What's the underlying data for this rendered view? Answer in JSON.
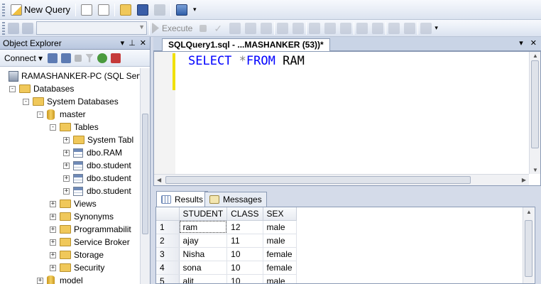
{
  "toolbar": {
    "new_query_label": "New Query",
    "execute_label": "Execute"
  },
  "object_explorer": {
    "title": "Object Explorer",
    "connect_label": "Connect",
    "tree": [
      {
        "label": "RAMASHANKER-PC (SQL Serv",
        "icon": "server-icon",
        "expander": "-"
      },
      {
        "label": "Databases",
        "icon": "folder-icon",
        "expander": "-"
      },
      {
        "label": "System Databases",
        "icon": "folder-icon",
        "expander": "-"
      },
      {
        "label": "master",
        "icon": "database-icon",
        "expander": "-"
      },
      {
        "label": "Tables",
        "icon": "folder-icon",
        "expander": "-"
      },
      {
        "label": "System Tabl",
        "icon": "folder-icon",
        "expander": "+"
      },
      {
        "label": "dbo.RAM",
        "icon": "table-icon",
        "expander": "+"
      },
      {
        "label": "dbo.student",
        "icon": "table-icon",
        "expander": "+"
      },
      {
        "label": "dbo.student",
        "icon": "table-icon",
        "expander": "+"
      },
      {
        "label": "dbo.student",
        "icon": "table-icon",
        "expander": "+"
      },
      {
        "label": "Views",
        "icon": "folder-icon",
        "expander": "+"
      },
      {
        "label": "Synonyms",
        "icon": "folder-icon",
        "expander": "+"
      },
      {
        "label": "Programmabilit",
        "icon": "folder-icon",
        "expander": "+"
      },
      {
        "label": "Service Broker",
        "icon": "folder-icon",
        "expander": "+"
      },
      {
        "label": "Storage",
        "icon": "folder-icon",
        "expander": "+"
      },
      {
        "label": "Security",
        "icon": "folder-icon",
        "expander": "+"
      },
      {
        "label": "model",
        "icon": "database-icon",
        "expander": "+"
      }
    ]
  },
  "editor": {
    "tab_title": "SQLQuery1.sql - ...MASHANKER (53))*",
    "code": {
      "kw1": "SELECT",
      "op": "*",
      "kw2": "FROM",
      "ident": "RAM"
    }
  },
  "results": {
    "tabs": [
      "Results",
      "Messages"
    ],
    "columns": [
      "STUDENT",
      "CLASS",
      "SEX"
    ],
    "rows": [
      {
        "n": "1",
        "student": "ram",
        "class": "12",
        "sex": "male"
      },
      {
        "n": "2",
        "student": "ajay",
        "class": "11",
        "sex": "male"
      },
      {
        "n": "3",
        "student": "Nisha",
        "class": "10",
        "sex": "female"
      },
      {
        "n": "4",
        "student": "sona",
        "class": "10",
        "sex": "female"
      },
      {
        "n": "5",
        "student": "alit",
        "class": "10",
        "sex": "male"
      }
    ]
  }
}
